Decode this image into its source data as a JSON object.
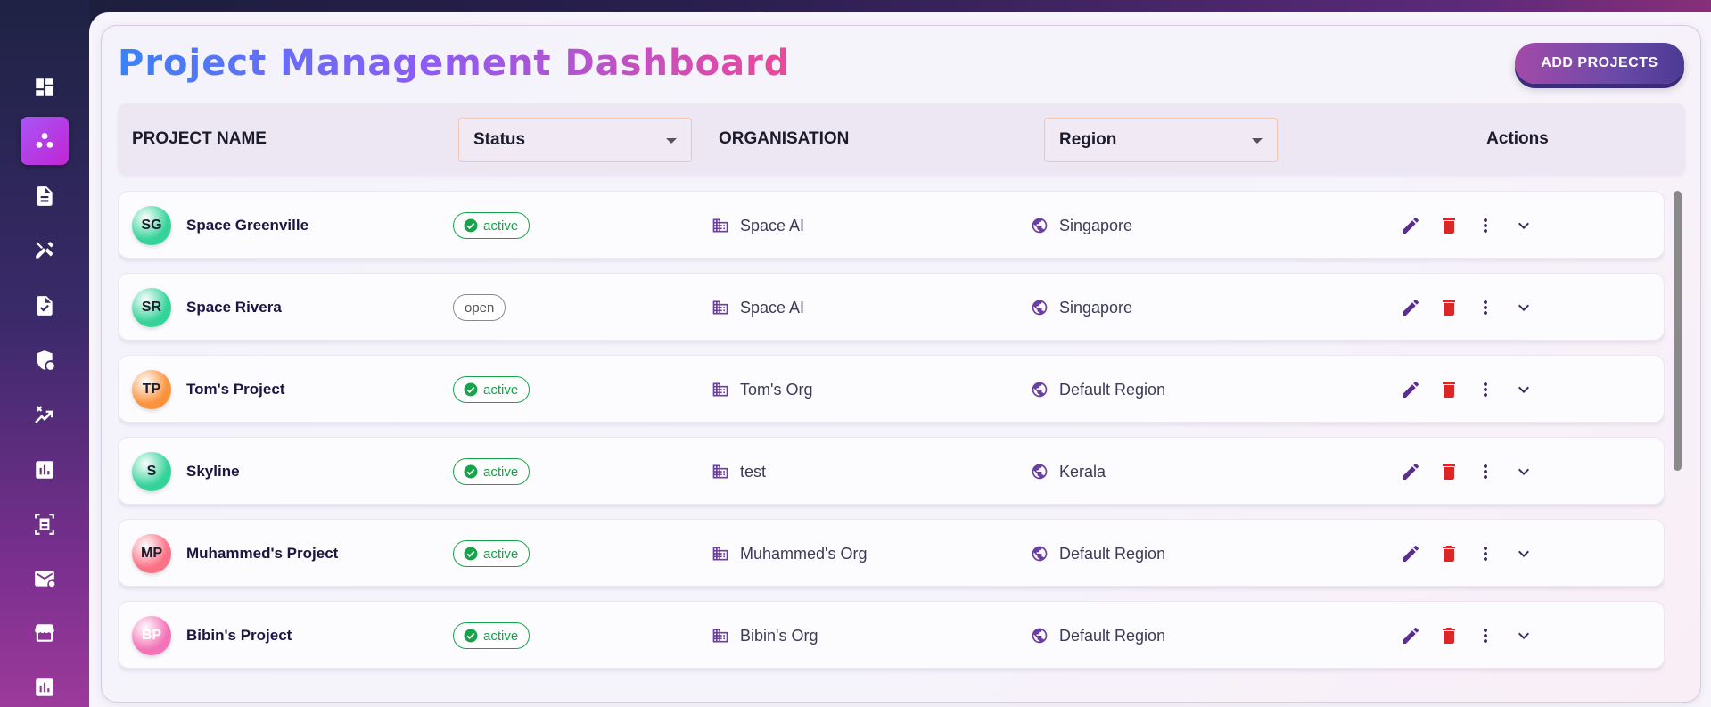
{
  "sidebar": {
    "items": [
      {
        "icon": "dashboard-icon",
        "active": false
      },
      {
        "icon": "projects-icon",
        "active": true
      },
      {
        "icon": "document-icon",
        "active": false
      },
      {
        "icon": "design-tools-icon",
        "active": false
      },
      {
        "icon": "task-check-icon",
        "active": false
      },
      {
        "icon": "security-shield-icon",
        "active": false
      },
      {
        "icon": "analytics-trend-icon",
        "active": false
      },
      {
        "icon": "bar-chart-icon",
        "active": false
      },
      {
        "icon": "document-scanner-icon",
        "active": false
      },
      {
        "icon": "mail-icon",
        "active": false
      },
      {
        "icon": "store-icon",
        "active": false
      },
      {
        "icon": "report-chart-icon",
        "active": false
      }
    ]
  },
  "header": {
    "title": "Project Management Dashboard",
    "add_button": "ADD PROJECTS"
  },
  "table": {
    "columns": {
      "project_name": "PROJECT NAME",
      "status": "Status",
      "organisation": "ORGANISATION",
      "region": "Region",
      "actions": "Actions"
    },
    "rows": [
      {
        "initials": "SG",
        "name": "Space Greenville",
        "status": "active",
        "org": "Space AI",
        "region": "Singapore",
        "avatar_color": "#34d399"
      },
      {
        "initials": "SR",
        "name": "Space Rivera",
        "status": "open",
        "org": "Space AI",
        "region": "Singapore",
        "avatar_color": "#34d399"
      },
      {
        "initials": "TP",
        "name": "Tom's Project",
        "status": "active",
        "org": "Tom's Org",
        "region": "Default Region",
        "avatar_color": "#fb923c"
      },
      {
        "initials": "S",
        "name": "Skyline",
        "status": "active",
        "org": "test",
        "region": "Kerala",
        "avatar_color": "#34d399"
      },
      {
        "initials": "MP",
        "name": "Muhammed's Project",
        "status": "active",
        "org": "Muhammed's Org",
        "region": "Default Region",
        "avatar_color": "#fb7185"
      },
      {
        "initials": "BP",
        "name": "Bibin's Project",
        "status": "active",
        "org": "Bibin's Org",
        "region": "Default Region",
        "avatar_color": "#f472b6"
      }
    ]
  },
  "colors": {
    "accent": "#6b3fa0",
    "active_green": "#16a34a",
    "delete_red": "#dc2626"
  }
}
